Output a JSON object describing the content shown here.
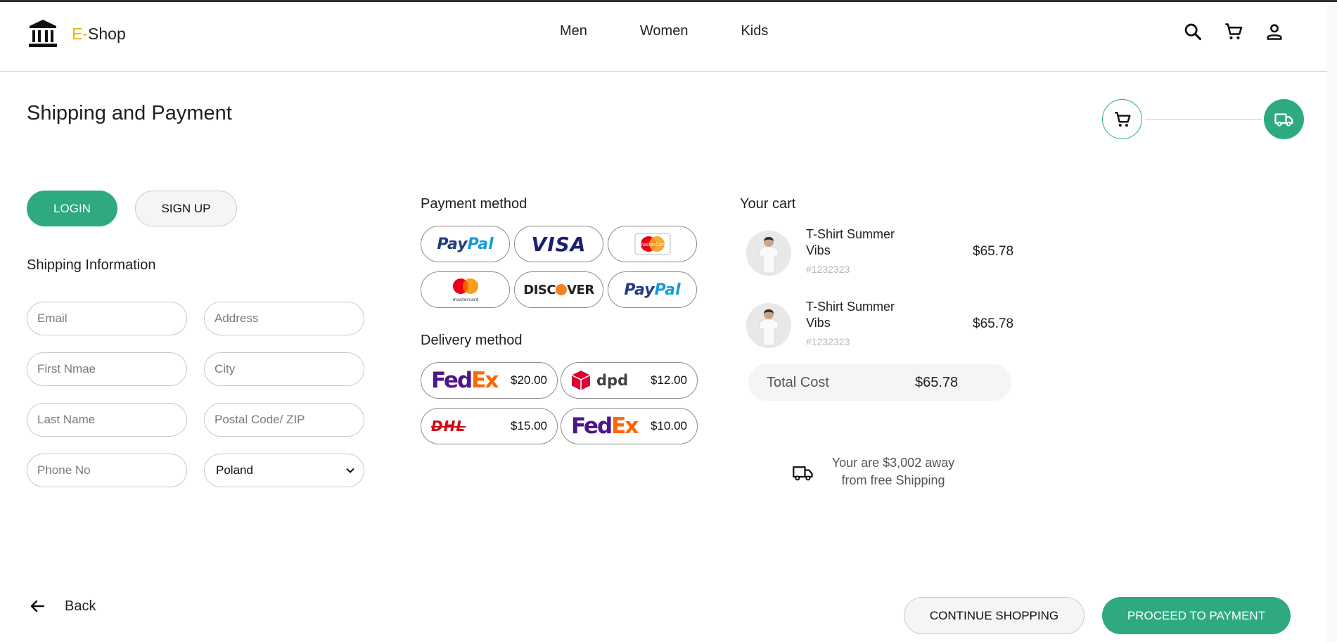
{
  "brand": {
    "prefix": "E",
    "dash": "-",
    "name": "Shop",
    "accent_color": "#f2b10a"
  },
  "nav": {
    "items": [
      {
        "label": "Men"
      },
      {
        "label": "Women"
      },
      {
        "label": "Kids"
      }
    ]
  },
  "header_icons": [
    "search-icon",
    "cart-icon",
    "account-icon"
  ],
  "page": {
    "title": "Shipping and Payment"
  },
  "progress": {
    "steps": [
      "cart-icon",
      "truck-icon"
    ],
    "active_color": "#2eaa7e"
  },
  "auth": {
    "login_label": "LOGIN",
    "signup_label": "SIGN UP"
  },
  "shipping": {
    "heading": "Shipping Information",
    "fields": {
      "email": {
        "placeholder": "Email",
        "value": ""
      },
      "address": {
        "placeholder": "Address",
        "value": ""
      },
      "first_name": {
        "placeholder": "First Nmae",
        "value": ""
      },
      "city": {
        "placeholder": "City",
        "value": ""
      },
      "last_name": {
        "placeholder": "Last Name",
        "value": ""
      },
      "postal_code": {
        "placeholder": "Postal Code/ ZIP",
        "value": ""
      },
      "phone": {
        "placeholder": "Phone No",
        "value": ""
      }
    },
    "country": {
      "selected": "Poland"
    }
  },
  "payment": {
    "heading": "Payment method",
    "options": [
      "paypal",
      "visa",
      "mastercard-card",
      "mastercard",
      "discover",
      "paypal"
    ],
    "paypal_text_a": "Pay",
    "paypal_text_b": "Pal",
    "visa_text": "VISA",
    "discover_text_a": "DISC",
    "discover_text_b": "VER",
    "mastercard_caption": "mastercard",
    "mastercard_card_text": "MasterCard"
  },
  "delivery": {
    "heading": "Delivery method",
    "options": [
      {
        "carrier": "FedEx",
        "price": "$20.00"
      },
      {
        "carrier": "dpd",
        "price": "$12.00"
      },
      {
        "carrier": "DHL",
        "price": "$15.00"
      },
      {
        "carrier": "FedEx",
        "price": "$10.00"
      }
    ],
    "fedex_fe": "Fed",
    "fedex_ex": "Ex",
    "dpd_text": "dpd",
    "dhl_text": "DHL"
  },
  "cart": {
    "heading": "Your cart",
    "items": [
      {
        "name": "T-Shirt Summer Vibs",
        "sku": "#1232323",
        "price": "$65.78"
      },
      {
        "name": "T-Shirt Summer Vibs",
        "sku": "#1232323",
        "price": "$65.78"
      }
    ],
    "total_label": "Total Cost",
    "total_value": "$65.78",
    "shipping_note": "Your are $3,002 away from free Shipping"
  },
  "footer": {
    "back_label": "Back",
    "continue_label": "CONTINUE SHOPPING",
    "proceed_label": "PROCEED TO PAYMENT"
  }
}
